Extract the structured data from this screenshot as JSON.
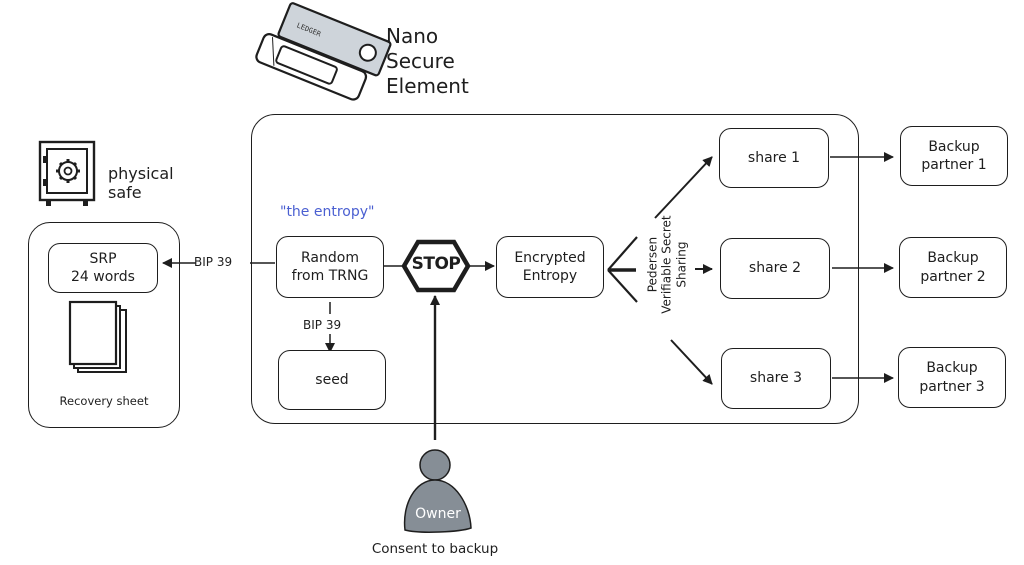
{
  "device": {
    "title_lines": [
      "Nano",
      "Secure",
      "Element"
    ],
    "brand_mark": "LEDGER",
    "icon": "hardware-wallet-icon"
  },
  "safe": {
    "icon": "safe-icon",
    "label_lines": [
      "physical",
      "safe"
    ],
    "srp_box": "SRP\n24 words",
    "recovery_icon": "paper-sheets-icon",
    "recovery_label": "Recovery sheet"
  },
  "entropy": {
    "annotation": "\"the entropy\"",
    "annotation_color": "#4a5fd1",
    "random_box": "Random\nfrom TRNG",
    "seed_box": "seed",
    "bip39_left": "BIP 39",
    "bip39_down": "BIP 39"
  },
  "stop": {
    "label": "STOP",
    "icon": "stop-sign-icon"
  },
  "encrypted_box": "Encrypted\nEntropy",
  "sharing_label_lines": [
    "Pedersen",
    "Verifiable Secret",
    "Sharing"
  ],
  "shares": [
    {
      "label": "share 1",
      "partner": "Backup\npartner 1"
    },
    {
      "label": "share 2",
      "partner": "Backup\npartner 2"
    },
    {
      "label": "share 3",
      "partner": "Backup\npartner 3"
    }
  ],
  "owner": {
    "label": "Owner",
    "icon": "person-icon",
    "fill": "#868e96",
    "caption": "Consent to backup"
  }
}
